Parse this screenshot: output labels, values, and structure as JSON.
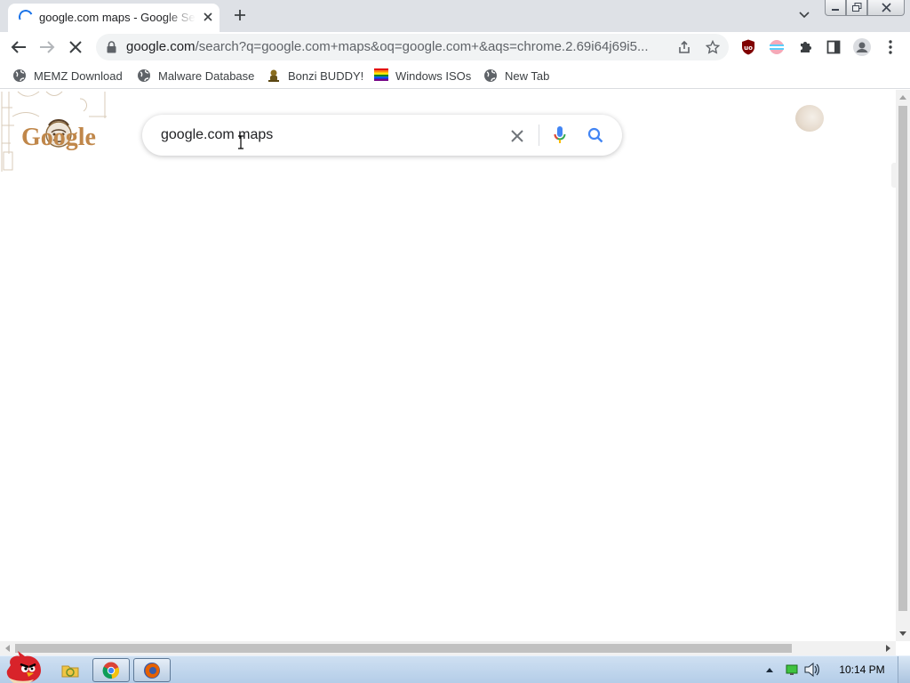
{
  "browser": {
    "tab": {
      "title": "google.com maps - Google Search"
    },
    "toolbar": {
      "url_host": "google.com",
      "url_rest": "/search?q=google.com+maps&oq=google.com+&aqs=chrome.2.69i64j69i5..."
    },
    "bookmarks": [
      {
        "label": "MEMZ Download",
        "icon": "globe-icon"
      },
      {
        "label": "Malware Database",
        "icon": "globe-icon"
      },
      {
        "label": "Bonzi BUDDY!",
        "icon": "bonzi-icon"
      },
      {
        "label": "Windows ISOs",
        "icon": "rainbow-flag-icon"
      },
      {
        "label": "New Tab",
        "icon": "globe-icon"
      }
    ]
  },
  "page": {
    "logo_text": "Google",
    "search": {
      "query": "google.com maps"
    }
  },
  "taskbar": {
    "clock": "10:14 PM"
  },
  "colors": {
    "accent": "#1a73e8",
    "tabstrip": "#dee1e6",
    "taskbar": "#b4cde8"
  }
}
